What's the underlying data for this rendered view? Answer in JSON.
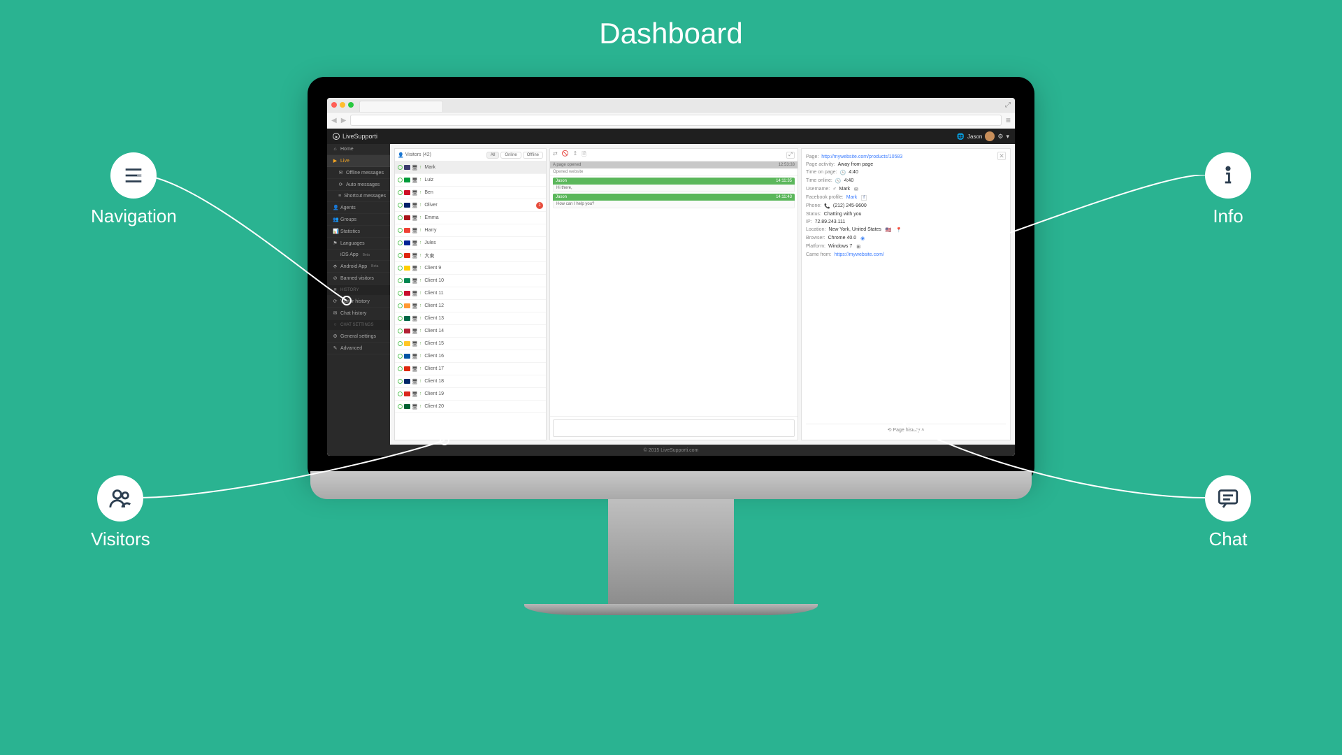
{
  "page_title": "Dashboard",
  "callouts": {
    "navigation": "Navigation",
    "info": "Info",
    "visitors": "Visitors",
    "chat": "Chat"
  },
  "app": {
    "brand": "LiveSupporti",
    "user_name": "Jason",
    "footer": "© 2015 LiveSupporti.com"
  },
  "sidebar": {
    "home": "Home",
    "live": "Live",
    "offline_messages": "Offline messages",
    "auto_messages": "Auto messages",
    "shortcut_messages": "Shortcut messages",
    "agents": "Agents",
    "groups": "Groups",
    "statistics": "Statistics",
    "languages": "Languages",
    "ios": "iOS App",
    "android": "Android App",
    "banned": "Banned visitors",
    "section_history": "HISTORY",
    "visitor_history": "Visitor history",
    "chat_history": "Chat history",
    "section_chat": "CHAT SETTINGS",
    "general": "General settings",
    "advanced": "Advanced",
    "beta": "Beta"
  },
  "visitors": {
    "title": "Visitors",
    "count": "(42)",
    "tabs": {
      "all": "All",
      "online": "Online",
      "offline": "Offline"
    },
    "list": [
      {
        "name": "Mark",
        "badge": ""
      },
      {
        "name": "Luiz",
        "badge": ""
      },
      {
        "name": "Ben",
        "badge": ""
      },
      {
        "name": "Oliver",
        "badge": "1"
      },
      {
        "name": "Emma",
        "badge": ""
      },
      {
        "name": "Harry",
        "badge": ""
      },
      {
        "name": "Jules",
        "badge": ""
      },
      {
        "name": "大東",
        "badge": ""
      },
      {
        "name": "Client 9",
        "badge": ""
      },
      {
        "name": "Client 10",
        "badge": ""
      },
      {
        "name": "Client 11",
        "badge": ""
      },
      {
        "name": "Client 12",
        "badge": ""
      },
      {
        "name": "Client 13",
        "badge": ""
      },
      {
        "name": "Client 14",
        "badge": ""
      },
      {
        "name": "Client 15",
        "badge": ""
      },
      {
        "name": "Client 16",
        "badge": ""
      },
      {
        "name": "Client 17",
        "badge": ""
      },
      {
        "name": "Client 18",
        "badge": ""
      },
      {
        "name": "Client 19",
        "badge": ""
      },
      {
        "name": "Client 20",
        "badge": ""
      }
    ]
  },
  "chat": {
    "subhead_left": "A page opened",
    "subhead_right": "12:53:33",
    "event": "Opened website",
    "messages": [
      {
        "sender": "Jason",
        "time": "14:11:35",
        "body": "Hi there,"
      },
      {
        "sender": "Jason",
        "time": "14:11:43",
        "body": "How can I help you?"
      }
    ]
  },
  "info": {
    "page_label": "Page:",
    "page_value": "http://mywebsite.com/products/10583",
    "activity_label": "Page activity:",
    "activity_value": "Away from page",
    "time_page_label": "Time on page:",
    "time_page_value": "4:40",
    "time_online_label": "Time online:",
    "time_online_value": "4:40",
    "username_label": "Username:",
    "username_value": "Mark",
    "fb_label": "Facebook profile:",
    "fb_value": "Mark",
    "phone_label": "Phone:",
    "phone_value": "(212) 245-9600",
    "status_label": "Status:",
    "status_value": "Chatting with you",
    "ip_label": "IP:",
    "ip_value": "72.89.243.111",
    "location_label": "Location:",
    "location_value": "New York, United States",
    "browser_label": "Browser:",
    "browser_value": "Chrome 40.0",
    "platform_label": "Platform:",
    "platform_value": "Windows 7",
    "came_label": "Came from:",
    "came_value": "https://mywebsite.com/",
    "history": "Page history"
  }
}
